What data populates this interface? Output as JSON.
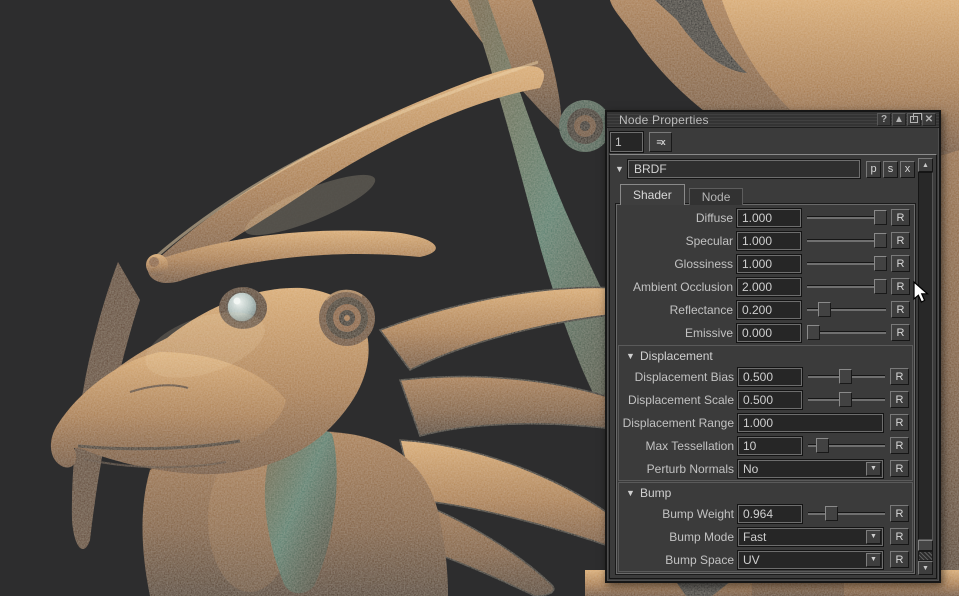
{
  "window": {
    "title": "Node Properties",
    "selection_count": "1",
    "pin_button_glyph": "≡x",
    "titlebar_buttons": [
      {
        "name": "help-icon",
        "glyph": "?"
      },
      {
        "name": "collapse-icon",
        "glyph": "▲"
      },
      {
        "name": "restore-icon",
        "glyph": "restore"
      },
      {
        "name": "close-icon",
        "glyph": "✕"
      }
    ]
  },
  "node_header": {
    "collapse_glyph": "▼",
    "node_name": "BRDF",
    "buttons": [
      {
        "name": "p-button",
        "label": "p"
      },
      {
        "name": "s-button",
        "label": "s"
      },
      {
        "name": "x-button",
        "label": "x"
      }
    ]
  },
  "tabs": [
    {
      "label": "Shader",
      "active": true
    },
    {
      "label": "Node",
      "active": false
    }
  ],
  "section_caret": "▼",
  "dropdown_arrow": "▼",
  "reset_label": "R",
  "scrollbar": {
    "up_glyph": "▲",
    "down_glyph": "▼"
  },
  "groups": [
    {
      "header": null,
      "rows": [
        {
          "type": "slider",
          "label": "Diffuse",
          "value": "1.000",
          "slider": 1.0
        },
        {
          "type": "slider",
          "label": "Specular",
          "value": "1.000",
          "slider": 1.0
        },
        {
          "type": "slider",
          "label": "Glossiness",
          "value": "1.000",
          "slider": 1.0
        },
        {
          "type": "slider",
          "label": "Ambient Occlusion",
          "value": "2.000",
          "slider": 1.0
        },
        {
          "type": "slider",
          "label": "Reflectance",
          "value": "0.200",
          "slider": 0.18
        },
        {
          "type": "slider",
          "label": "Emissive",
          "value": "0.000",
          "slider": 0.02
        }
      ]
    },
    {
      "header": "Displacement",
      "rows": [
        {
          "type": "slider",
          "label": "Displacement Bias",
          "value": "0.500",
          "slider": 0.48
        },
        {
          "type": "slider",
          "label": "Displacement Scale",
          "value": "0.500",
          "slider": 0.48
        },
        {
          "type": "field",
          "label": "Displacement Range",
          "value": "1.000"
        },
        {
          "type": "slider",
          "label": "Max Tessellation",
          "value": "10",
          "slider": 0.14
        },
        {
          "type": "dropdown",
          "label": "Perturb Normals",
          "value": "No"
        }
      ]
    },
    {
      "header": "Bump",
      "rows": [
        {
          "type": "slider",
          "label": "Bump Weight",
          "value": "0.964",
          "slider": 0.28
        },
        {
          "type": "dropdown",
          "label": "Bump Mode",
          "value": "Fast"
        },
        {
          "type": "dropdown",
          "label": "Bump Space",
          "value": "UV"
        }
      ]
    }
  ],
  "colors": {
    "background": "#2d2d2e",
    "panel_bg": "#3b3b3b",
    "field_bg": "#262626",
    "button_bg": "#3e3e3e",
    "text": "#c6c6c6",
    "accent_border": "#787878",
    "copper_light": "#d8a96e",
    "copper": "#a97a47",
    "copper_dark": "#6d4a2b",
    "patina_teal": "#4e7b6a",
    "eye_gray": "#bcc8c5"
  }
}
